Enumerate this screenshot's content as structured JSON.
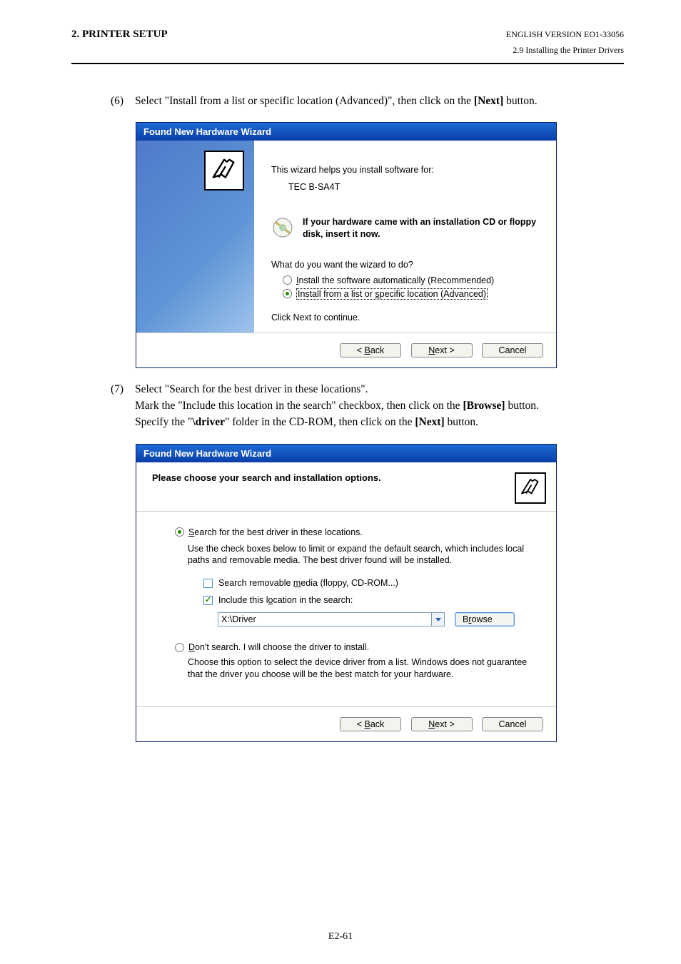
{
  "header": {
    "section": "2. PRINTER SETUP",
    "version": "ENGLISH VERSION EO1-33056",
    "subsection": "2.9 Installing the Printer Drivers"
  },
  "step6": {
    "num": "(6)",
    "text_a": "Select \"Install from a list or specific location (Advanced)\", then click on the ",
    "text_b": "[Next]",
    "text_c": " button."
  },
  "dialog1": {
    "title": "Found New Hardware Wizard",
    "intro": "This wizard helps you install software for:",
    "product": "TEC B-SA4T",
    "cd_text": "If your hardware came with an installation CD or floppy disk, insert it now.",
    "question": "What do you want the wizard to do?",
    "opt1_pre": "I",
    "opt1_rest": "nstall the software automatically (Recommended)",
    "opt2_a": "Install from a list or ",
    "opt2_mn": "s",
    "opt2_b": "pecific location (Advanced)",
    "continue": "Click Next to continue.",
    "back_mn": "B",
    "back_rest": "ack",
    "next_mn": "N",
    "next_rest": "ext >",
    "cancel": "Cancel"
  },
  "step7": {
    "num": "(7)",
    "line1": "Select \"Search for the best driver in these locations\".",
    "line2_a": "Mark the \"Include this location in the search\" checkbox, then click on the ",
    "line2_b": "[Browse]",
    "line2_c": " button.",
    "line3_a": "Specify the \"",
    "line3_b": "\\driver",
    "line3_c": "\" folder in the CD-ROM, then click on the ",
    "line3_d": "[Next]",
    "line3_e": " button."
  },
  "dialog2": {
    "title": "Found New Hardware Wizard",
    "heading": "Please choose your search and installation options.",
    "r1_mn": "S",
    "r1_rest": "earch for the best driver in these locations.",
    "r1_help": "Use the check boxes below to limit or expand the default search, which includes local paths and removable media. The best driver found will be installed.",
    "cb1_a": "Search removable ",
    "cb1_mn": "m",
    "cb1_b": "edia (floppy, CD-ROM...)",
    "cb2_a": "Include this l",
    "cb2_mn": "o",
    "cb2_b": "cation in the search:",
    "path": "X:\\Driver",
    "browse_mn": "r",
    "browse_a": "B",
    "browse_b": "owse",
    "r2_mn": "D",
    "r2_rest": "on't search. I will choose the driver to install.",
    "r2_help": "Choose this option to select the device driver from a list.  Windows does not guarantee that the driver you choose will be the best match for your hardware.",
    "back_mn": "B",
    "back_rest": "ack",
    "next_mn": "N",
    "next_rest": "ext >",
    "cancel": "Cancel"
  },
  "page": "E2-61"
}
